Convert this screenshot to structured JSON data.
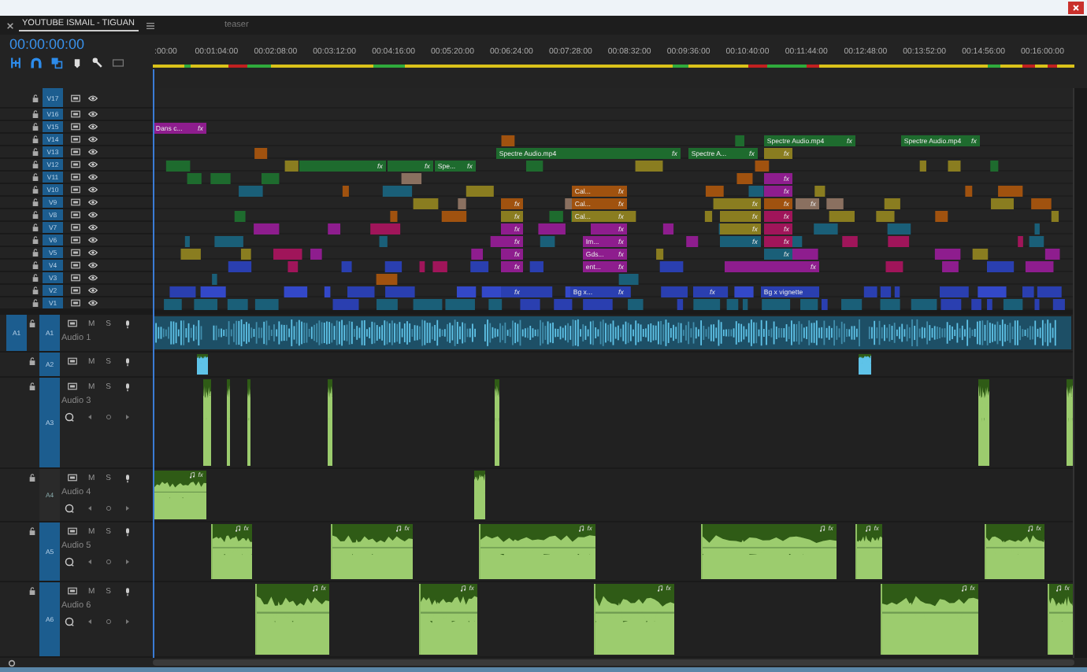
{
  "tabs": [
    {
      "label": "YOUTUBE ISMAIL - TIGUAN",
      "selected": true
    },
    {
      "label": "teaser",
      "selected": false
    }
  ],
  "timecode": "00:00:00:00",
  "ruler": {
    "ticks": [
      ":00:00",
      "00:01:04:00",
      "00:02:08:00",
      "00:03:12:00",
      "00:04:16:00",
      "00:05:20:00",
      "00:06:24:00",
      "00:07:28:00",
      "00:08:32:00",
      "00:09:36:00",
      "00:10:40:00",
      "00:11:44:00",
      "00:12:48:00",
      "00:13:52:00",
      "00:14:56:00",
      "00:16:00:00"
    ]
  },
  "video_tracks": [
    {
      "name": "V17",
      "targeted": true
    },
    {
      "name": "V16",
      "targeted": true
    },
    {
      "name": "V15",
      "targeted": true,
      "clips": [
        {
          "label": "Dans c...",
          "badge": "fx",
          "color": "#8e1d8e"
        }
      ]
    },
    {
      "name": "V14",
      "targeted": true,
      "clips": [
        {
          "label": "Spectre Audio.mp4",
          "badge": "fx",
          "color": "#1e6b2e"
        },
        {
          "label": "Spectre Audio.mp4",
          "badge": "fx",
          "color": "#1e6b2e"
        }
      ]
    },
    {
      "name": "V13",
      "targeted": true,
      "clips": [
        {
          "label": "Spectre Audio.mp4",
          "badge": "fx",
          "color": "#1e6b2e"
        },
        {
          "label": "Spectre A...",
          "badge": "fx",
          "color": "#1e6b2e"
        },
        {
          "badge": "fx",
          "color": "#8a7d20"
        }
      ]
    },
    {
      "name": "V12",
      "targeted": true,
      "clips": [
        {
          "badge": "fx",
          "color": "#1e6b2e"
        },
        {
          "badge": "fx",
          "color": "#1e6b2e"
        },
        {
          "label": "Spe...",
          "badge": "fx",
          "color": "#1e6b2e"
        }
      ]
    },
    {
      "name": "V11",
      "targeted": true,
      "clips": [
        {
          "badge": "fx",
          "color": "#8e1d8e"
        }
      ]
    },
    {
      "name": "V10",
      "targeted": true,
      "clips": [
        {
          "label": "Cal...",
          "badge": "fx",
          "color": "#a0520f"
        },
        {
          "badge": "fx",
          "color": "#8e1d8e"
        }
      ]
    },
    {
      "name": "V9",
      "targeted": true,
      "clips": [
        {
          "badge": "fx",
          "color": "#a0520f"
        },
        {
          "label": "Cal...",
          "badge": "fx",
          "color": "#a0520f"
        },
        {
          "badge": "fx",
          "color": "#8a7d20"
        },
        {
          "badge": "fx",
          "color": "#a0520f"
        },
        {
          "badge": "fx",
          "color": "#8a7060"
        }
      ]
    },
    {
      "name": "V8",
      "targeted": true,
      "clips": [
        {
          "badge": "fx",
          "color": "#8a7d20"
        },
        {
          "label": "Cal...",
          "badge": "fx",
          "color": "#8a7d20"
        },
        {
          "badge": "fx",
          "color": "#8a7d20"
        },
        {
          "badge": "fx",
          "color": "#a0155a"
        }
      ]
    },
    {
      "name": "V7",
      "targeted": true,
      "clips": [
        {
          "badge": "fx",
          "color": "#8e1d8e"
        },
        {
          "badge": "fx",
          "color": "#8e1d8e"
        },
        {
          "badge": "fx",
          "color": "#8a7d20"
        },
        {
          "badge": "fx",
          "color": "#a0155a"
        }
      ]
    },
    {
      "name": "V6",
      "targeted": true,
      "clips": [
        {
          "badge": "fx",
          "color": "#8e1d8e"
        },
        {
          "label": "Im...",
          "badge": "fx",
          "color": "#8e1d8e"
        },
        {
          "badge": "fx",
          "color": "#1a5f78"
        },
        {
          "badge": "fx",
          "color": "#a0155a"
        }
      ]
    },
    {
      "name": "V5",
      "targeted": true,
      "clips": [
        {
          "badge": "fx",
          "color": "#8e1d8e"
        },
        {
          "label": "Gds...",
          "badge": "fx",
          "color": "#8e1d8e"
        },
        {
          "badge": "fx",
          "color": "#1a5f78"
        }
      ]
    },
    {
      "name": "V4",
      "targeted": true,
      "clips": [
        {
          "badge": "fx",
          "color": "#8e1d8e"
        },
        {
          "label": "ent...",
          "badge": "fx",
          "color": "#8e1d8e"
        },
        {
          "badge": "fx",
          "color": "#8e1d8e"
        }
      ]
    },
    {
      "name": "V3",
      "targeted": true
    },
    {
      "name": "V2",
      "targeted": true,
      "clips": [
        {
          "badge": "fx",
          "color": "#2a3fb0"
        },
        {
          "label": "Bg x...",
          "badge": "fx",
          "color": "#2a3fb0"
        },
        {
          "badge": "fx",
          "color": "#2a3fb0"
        },
        {
          "label": "Bg x vignette",
          "color": "#2a3fb0"
        }
      ]
    },
    {
      "name": "V1",
      "targeted": true
    }
  ],
  "audio_tracks": [
    {
      "name": "A1",
      "source": "A1",
      "title": "Audio 1",
      "targeted": true,
      "mute": "M",
      "solo": "S",
      "clips": [
        {
          "kind": "strip",
          "color": "#5fc3e8"
        }
      ]
    },
    {
      "name": "A2",
      "targeted": true,
      "mute": "M",
      "solo": "S",
      "clips": [
        {
          "kind": "thin",
          "color": "#5fc3e8"
        },
        {
          "kind": "thin",
          "color": "#5fc3e8"
        }
      ]
    },
    {
      "name": "A3",
      "title": "Audio 3",
      "targeted": true,
      "mute": "M",
      "solo": "S",
      "clips": [
        {
          "kind": "thin",
          "color": "#9ccc6e"
        },
        {
          "kind": "thin",
          "color": "#9ccc6e"
        },
        {
          "kind": "thin",
          "color": "#9ccc6e"
        },
        {
          "kind": "thin",
          "color": "#9ccc6e"
        },
        {
          "kind": "thin",
          "color": "#9ccc6e"
        },
        {
          "kind": "thin",
          "color": "#9ccc6e"
        },
        {
          "kind": "thin",
          "color": "#9ccc6e"
        }
      ]
    },
    {
      "name": "A4",
      "title": "Audio 4",
      "targeted": false,
      "mute": "M",
      "solo": "S",
      "clips": [
        {
          "kind": "full",
          "badge": "fx",
          "color": "#9ccc6e"
        },
        {
          "kind": "thin",
          "color": "#9ccc6e"
        }
      ]
    },
    {
      "name": "A5",
      "title": "Audio 5",
      "targeted": true,
      "mute": "M",
      "solo": "S",
      "clips": [
        {
          "kind": "full",
          "badge": "fx",
          "color": "#9ccc6e"
        },
        {
          "kind": "full",
          "badge": "fx",
          "color": "#9ccc6e"
        },
        {
          "kind": "full",
          "badge": "fx",
          "color": "#9ccc6e"
        },
        {
          "kind": "full",
          "badge": "fx",
          "color": "#9ccc6e"
        },
        {
          "kind": "full",
          "badge": "fx",
          "color": "#9ccc6e"
        },
        {
          "kind": "full",
          "badge": "fx",
          "color": "#9ccc6e"
        }
      ]
    },
    {
      "name": "A6",
      "title": "Audio 6",
      "targeted": true,
      "mute": "M",
      "solo": "S",
      "clips": [
        {
          "kind": "full",
          "badge": "fx",
          "color": "#9ccc6e"
        },
        {
          "kind": "full",
          "badge": "fx",
          "color": "#9ccc6e"
        },
        {
          "kind": "full",
          "badge": "fx",
          "color": "#9ccc6e"
        },
        {
          "kind": "full",
          "badge": "fx",
          "color": "#9ccc6e"
        },
        {
          "kind": "full",
          "badge": "fx",
          "color": "#9ccc6e"
        }
      ]
    }
  ]
}
